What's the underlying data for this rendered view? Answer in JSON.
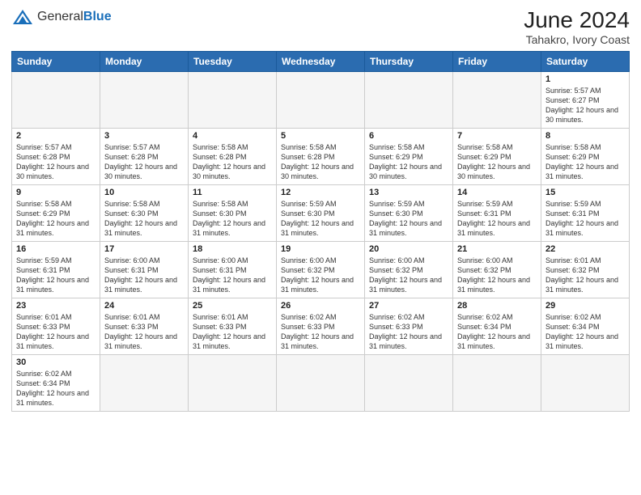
{
  "header": {
    "logo_text_general": "General",
    "logo_text_blue": "Blue",
    "title": "June 2024",
    "subtitle": "Tahakro, Ivory Coast"
  },
  "weekdays": [
    "Sunday",
    "Monday",
    "Tuesday",
    "Wednesday",
    "Thursday",
    "Friday",
    "Saturday"
  ],
  "weeks": [
    [
      {
        "day": "",
        "empty": true
      },
      {
        "day": "",
        "empty": true
      },
      {
        "day": "",
        "empty": true
      },
      {
        "day": "",
        "empty": true
      },
      {
        "day": "",
        "empty": true
      },
      {
        "day": "",
        "empty": true
      },
      {
        "day": "1",
        "sunrise": "5:57 AM",
        "sunset": "6:27 PM",
        "daylight": "12 hours and 30 minutes."
      }
    ],
    [
      {
        "day": "2",
        "sunrise": "5:57 AM",
        "sunset": "6:28 PM",
        "daylight": "12 hours and 30 minutes."
      },
      {
        "day": "3",
        "sunrise": "5:57 AM",
        "sunset": "6:28 PM",
        "daylight": "12 hours and 30 minutes."
      },
      {
        "day": "4",
        "sunrise": "5:58 AM",
        "sunset": "6:28 PM",
        "daylight": "12 hours and 30 minutes."
      },
      {
        "day": "5",
        "sunrise": "5:58 AM",
        "sunset": "6:28 PM",
        "daylight": "12 hours and 30 minutes."
      },
      {
        "day": "6",
        "sunrise": "5:58 AM",
        "sunset": "6:29 PM",
        "daylight": "12 hours and 30 minutes."
      },
      {
        "day": "7",
        "sunrise": "5:58 AM",
        "sunset": "6:29 PM",
        "daylight": "12 hours and 30 minutes."
      },
      {
        "day": "8",
        "sunrise": "5:58 AM",
        "sunset": "6:29 PM",
        "daylight": "12 hours and 31 minutes."
      }
    ],
    [
      {
        "day": "9",
        "sunrise": "5:58 AM",
        "sunset": "6:29 PM",
        "daylight": "12 hours and 31 minutes."
      },
      {
        "day": "10",
        "sunrise": "5:58 AM",
        "sunset": "6:30 PM",
        "daylight": "12 hours and 31 minutes."
      },
      {
        "day": "11",
        "sunrise": "5:58 AM",
        "sunset": "6:30 PM",
        "daylight": "12 hours and 31 minutes."
      },
      {
        "day": "12",
        "sunrise": "5:59 AM",
        "sunset": "6:30 PM",
        "daylight": "12 hours and 31 minutes."
      },
      {
        "day": "13",
        "sunrise": "5:59 AM",
        "sunset": "6:30 PM",
        "daylight": "12 hours and 31 minutes."
      },
      {
        "day": "14",
        "sunrise": "5:59 AM",
        "sunset": "6:31 PM",
        "daylight": "12 hours and 31 minutes."
      },
      {
        "day": "15",
        "sunrise": "5:59 AM",
        "sunset": "6:31 PM",
        "daylight": "12 hours and 31 minutes."
      }
    ],
    [
      {
        "day": "16",
        "sunrise": "5:59 AM",
        "sunset": "6:31 PM",
        "daylight": "12 hours and 31 minutes."
      },
      {
        "day": "17",
        "sunrise": "6:00 AM",
        "sunset": "6:31 PM",
        "daylight": "12 hours and 31 minutes."
      },
      {
        "day": "18",
        "sunrise": "6:00 AM",
        "sunset": "6:31 PM",
        "daylight": "12 hours and 31 minutes."
      },
      {
        "day": "19",
        "sunrise": "6:00 AM",
        "sunset": "6:32 PM",
        "daylight": "12 hours and 31 minutes."
      },
      {
        "day": "20",
        "sunrise": "6:00 AM",
        "sunset": "6:32 PM",
        "daylight": "12 hours and 31 minutes."
      },
      {
        "day": "21",
        "sunrise": "6:00 AM",
        "sunset": "6:32 PM",
        "daylight": "12 hours and 31 minutes."
      },
      {
        "day": "22",
        "sunrise": "6:01 AM",
        "sunset": "6:32 PM",
        "daylight": "12 hours and 31 minutes."
      }
    ],
    [
      {
        "day": "23",
        "sunrise": "6:01 AM",
        "sunset": "6:33 PM",
        "daylight": "12 hours and 31 minutes."
      },
      {
        "day": "24",
        "sunrise": "6:01 AM",
        "sunset": "6:33 PM",
        "daylight": "12 hours and 31 minutes."
      },
      {
        "day": "25",
        "sunrise": "6:01 AM",
        "sunset": "6:33 PM",
        "daylight": "12 hours and 31 minutes."
      },
      {
        "day": "26",
        "sunrise": "6:02 AM",
        "sunset": "6:33 PM",
        "daylight": "12 hours and 31 minutes."
      },
      {
        "day": "27",
        "sunrise": "6:02 AM",
        "sunset": "6:33 PM",
        "daylight": "12 hours and 31 minutes."
      },
      {
        "day": "28",
        "sunrise": "6:02 AM",
        "sunset": "6:34 PM",
        "daylight": "12 hours and 31 minutes."
      },
      {
        "day": "29",
        "sunrise": "6:02 AM",
        "sunset": "6:34 PM",
        "daylight": "12 hours and 31 minutes."
      }
    ],
    [
      {
        "day": "30",
        "sunrise": "6:02 AM",
        "sunset": "6:34 PM",
        "daylight": "12 hours and 31 minutes."
      },
      {
        "day": "",
        "empty": true
      },
      {
        "day": "",
        "empty": true
      },
      {
        "day": "",
        "empty": true
      },
      {
        "day": "",
        "empty": true
      },
      {
        "day": "",
        "empty": true
      },
      {
        "day": "",
        "empty": true
      }
    ]
  ]
}
